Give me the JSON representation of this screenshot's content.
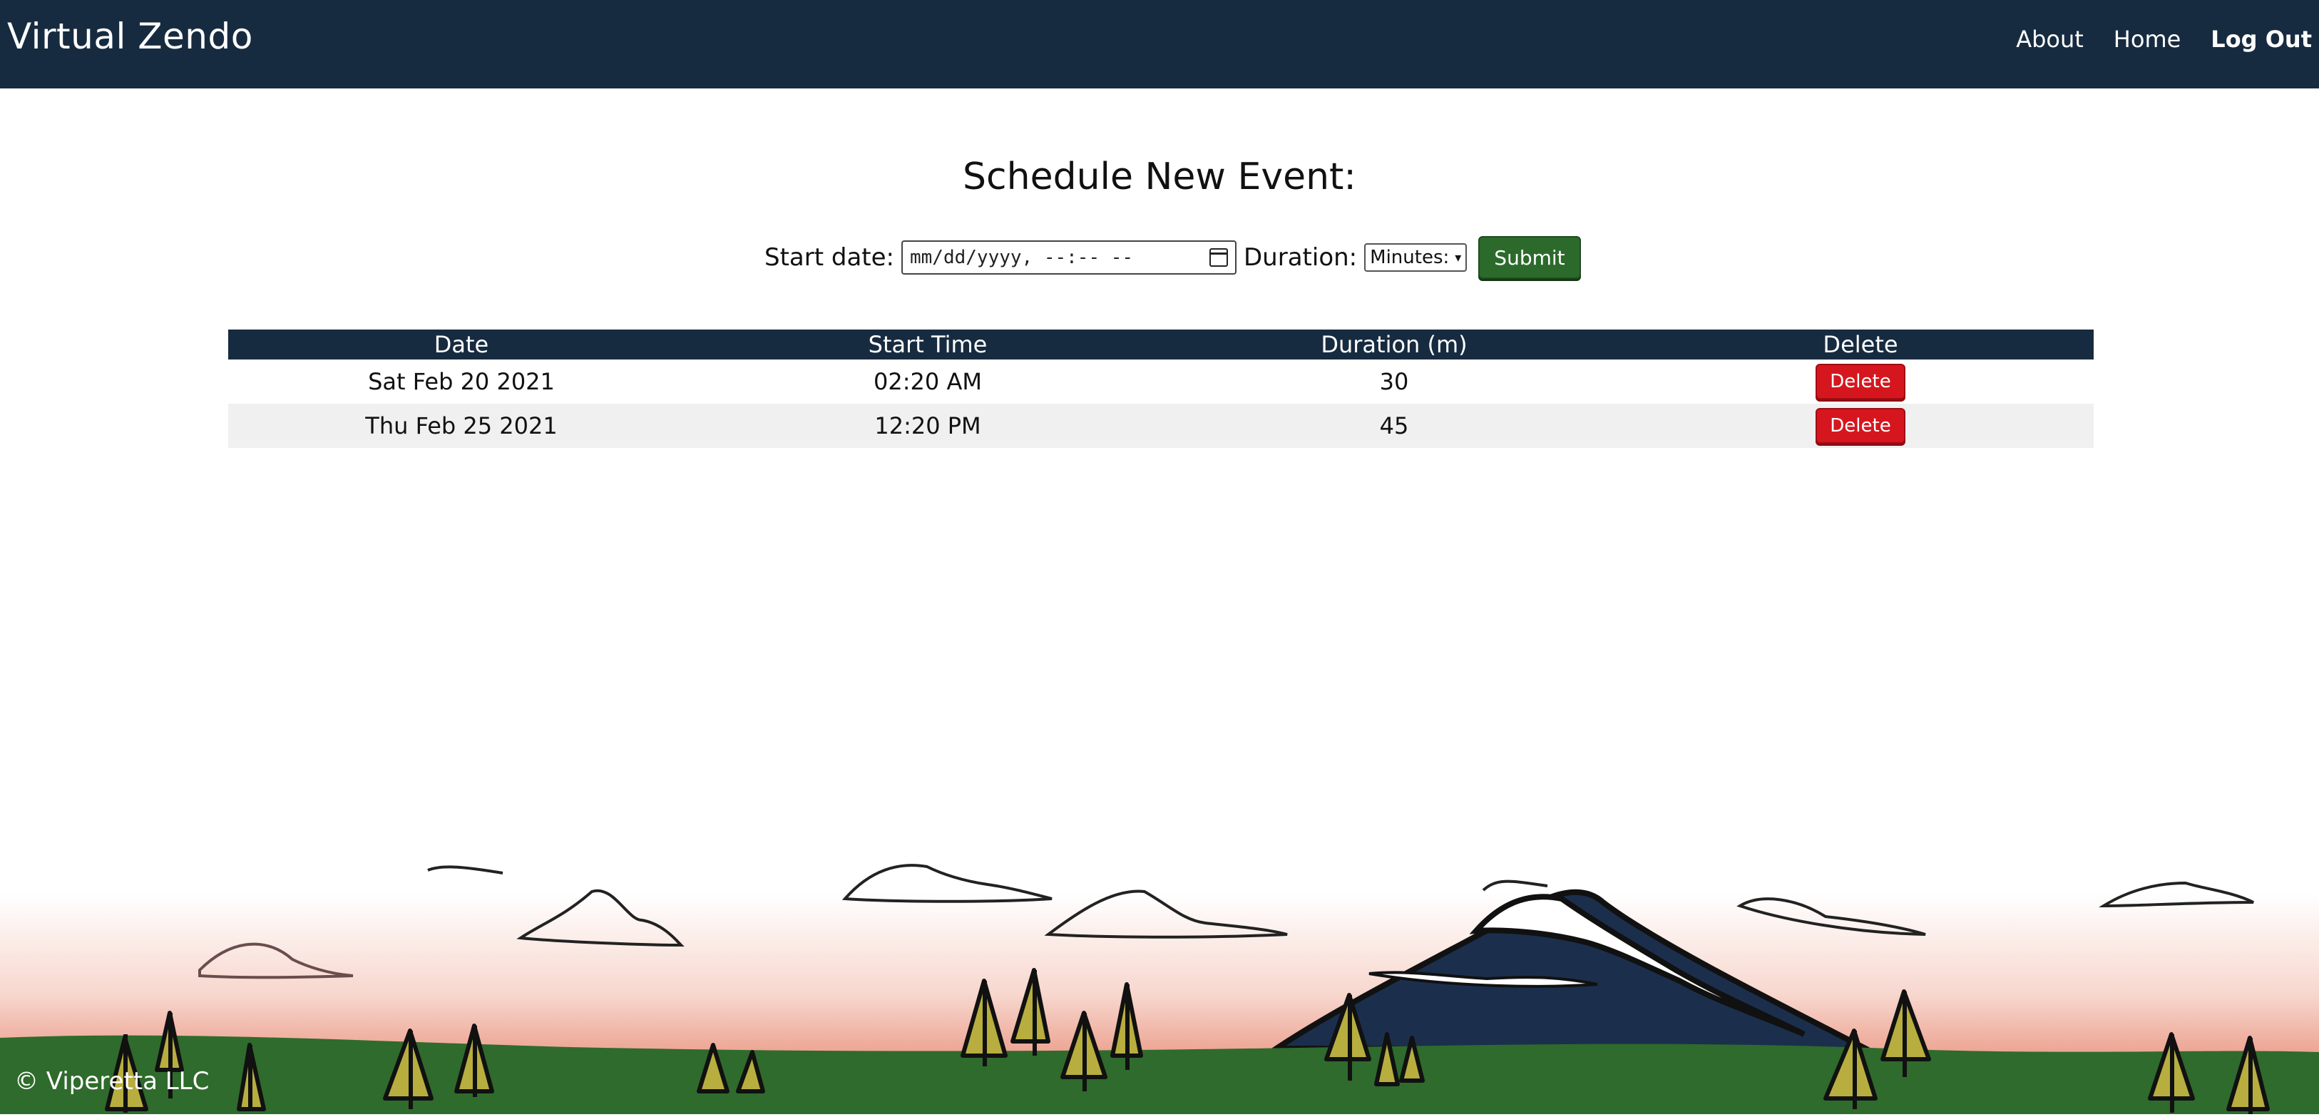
{
  "header": {
    "brand": "Virtual Zendo",
    "nav": [
      "About",
      "Home",
      "Log Out"
    ]
  },
  "form": {
    "title": "Schedule New Event:",
    "start_label": "Start date:",
    "date_placeholder": "mm/dd/yyyy, --:-- --",
    "duration_label": "Duration:",
    "duration_selected": "Minutes:",
    "submit_label": "Submit"
  },
  "table": {
    "columns": [
      "Date",
      "Start Time",
      "Duration (m)",
      "Delete"
    ],
    "rows": [
      {
        "date": "Sat Feb 20 2021",
        "start": "02:20 AM",
        "duration": "30",
        "delete": "Delete"
      },
      {
        "date": "Thu Feb 25 2021",
        "start": "12:20 PM",
        "duration": "45",
        "delete": "Delete"
      }
    ]
  },
  "footer": {
    "copyright": "© Viperetta LLC"
  },
  "colors": {
    "header_bg": "#172b40",
    "submit_bg": "#2c6a2c",
    "delete_bg": "#d6161e",
    "ground_green": "#2f6b2c",
    "sunset_orange": "#e26f55",
    "mountain_navy": "#1b2f4d"
  }
}
